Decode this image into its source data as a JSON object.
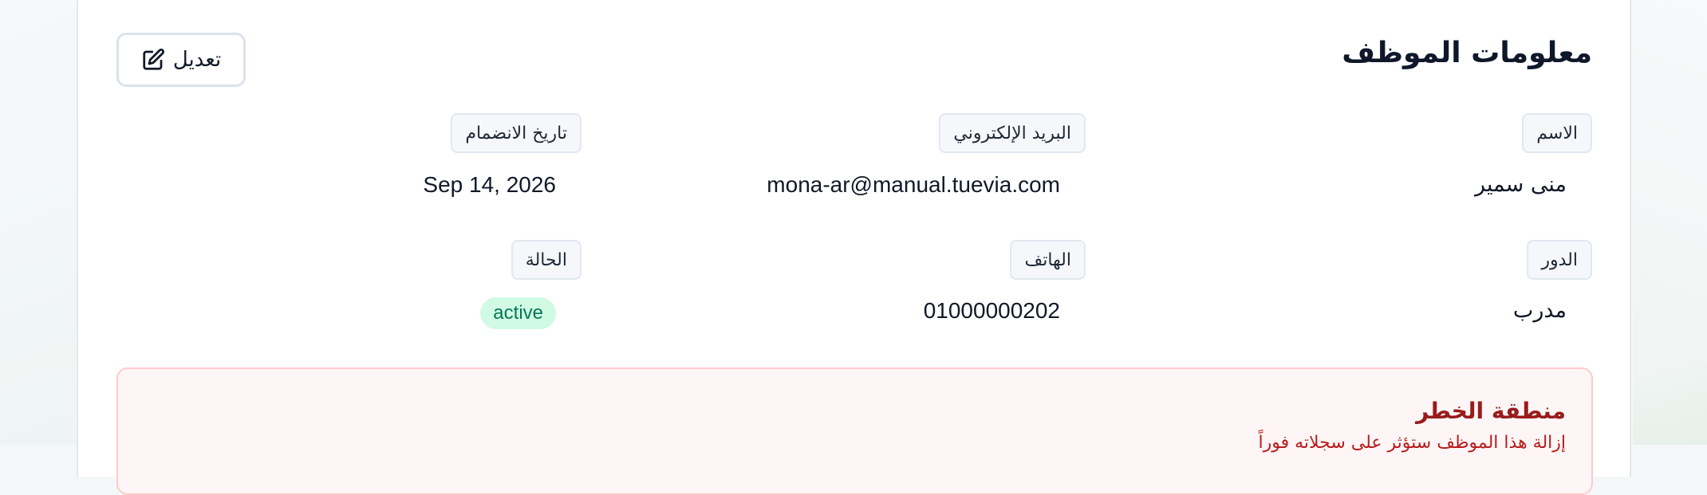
{
  "page": {
    "title": "معلومات الموظف",
    "edit_label": "تعديل"
  },
  "fields": {
    "name": {
      "label": "الاسم",
      "value": "منى سمير"
    },
    "email": {
      "label": "البريد الإلكتروني",
      "value": "mona-ar@manual.tuevia.com"
    },
    "join_date": {
      "label": "تاريخ الانضمام",
      "value": "Sep 14, 2026"
    },
    "role": {
      "label": "الدور",
      "value": "مدرب"
    },
    "phone": {
      "label": "الهاتف",
      "value": "01000000202"
    },
    "status": {
      "label": "الحالة",
      "value": "active"
    }
  },
  "danger_zone": {
    "title": "منطقة الخطر",
    "text": "إزالة هذا الموظف ستؤثر على سجلاته فوراً"
  },
  "colors": {
    "accent_status_bg": "#d1fae5",
    "accent_status_text": "#047857",
    "danger_border": "#fecaca",
    "danger_title": "#991b1b"
  },
  "icons": {
    "edit": "pencil-square-icon"
  }
}
